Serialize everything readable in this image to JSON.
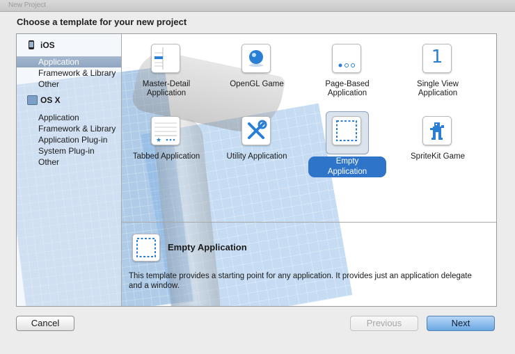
{
  "window": {
    "title": "New Project"
  },
  "heading": "Choose a template for your new project",
  "sidebar": {
    "sections": [
      {
        "label": "iOS",
        "icon": "iphone-icon",
        "items": [
          "Application",
          "Framework & Library",
          "Other"
        ]
      },
      {
        "label": "OS X",
        "icon": "mac-icon",
        "items": [
          "Application",
          "Framework & Library",
          "Application Plug-in",
          "System Plug-in",
          "Other"
        ]
      }
    ],
    "selected": "iOS / Application"
  },
  "templates": [
    {
      "label_line1": "Master-Detail",
      "label_line2": "Application",
      "icon": "master-detail-icon"
    },
    {
      "label_line1": "OpenGL Game",
      "label_line2": "",
      "icon": "opengl-game-icon"
    },
    {
      "label_line1": "Page-Based",
      "label_line2": "Application",
      "icon": "page-based-icon"
    },
    {
      "label_line1": "Single View",
      "label_line2": "Application",
      "icon": "single-view-icon",
      "glyph": "1"
    },
    {
      "label_line1": "Tabbed Application",
      "label_line2": "",
      "icon": "tabbed-icon"
    },
    {
      "label_line1": "Utility Application",
      "label_line2": "",
      "icon": "utility-icon"
    },
    {
      "label_line1": "Empty Application",
      "label_line2": "",
      "icon": "empty-application-icon",
      "selected": true
    },
    {
      "label_line1": "SpriteKit Game",
      "label_line2": "",
      "icon": "spritekit-game-icon"
    }
  ],
  "description": {
    "title": "Empty Application",
    "text": "This template provides a starting point for any application. It provides just an application delegate and a window."
  },
  "buttons": {
    "cancel": "Cancel",
    "previous": "Previous",
    "next": "Next"
  },
  "colors": {
    "selection": "#2e74c9",
    "accent": "#2a7fd4"
  }
}
